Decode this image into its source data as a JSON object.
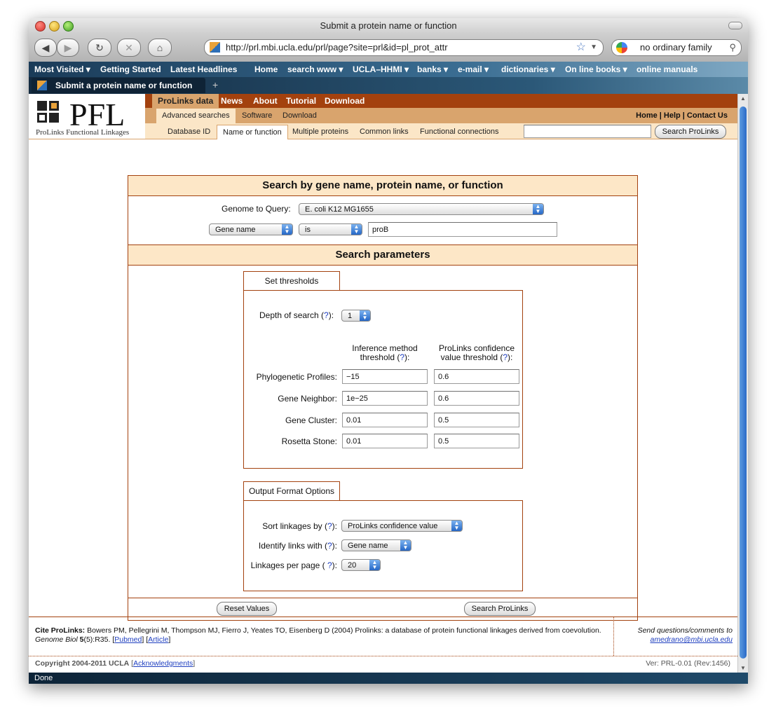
{
  "window": {
    "title": "Submit a protein name or function"
  },
  "toolbar": {
    "url": "http://prl.mbi.ucla.edu/prl/page?site=prl&id=pl_prot_attr",
    "search_value": "no ordinary family"
  },
  "bookmarks": [
    "Most Visited ▾",
    "Getting Started",
    "Latest Headlines",
    "Home",
    "search www ▾",
    "UCLA–HHMI ▾",
    "banks ▾",
    "e-mail ▾",
    "dictionaries ▾",
    "On line books ▾",
    "online manuals"
  ],
  "tab": {
    "title": "Submit a protein name or function"
  },
  "status": {
    "text": "Done"
  },
  "site": {
    "logo": "PFL",
    "logo_sub": "ProLinks Functional Linkages",
    "nav1": [
      "ProLinks data",
      "News",
      "About",
      "Tutorial",
      "Download"
    ],
    "nav2": [
      "Advanced searches",
      "Software",
      "Download"
    ],
    "nav2_right": "Home | Help | Contact Us",
    "nav3": [
      "Database ID",
      "Name or function",
      "Multiple proteins",
      "Common links",
      "Functional connections"
    ],
    "search_button": "Search ProLinks"
  },
  "form": {
    "title": "Search by gene name, protein name, or function",
    "genome_label": "Genome to Query:",
    "genome_value": "E. coli K12 MG1655",
    "field_select": "Gene name",
    "op_select": "is",
    "query_value": "proB",
    "params_title": "Search parameters",
    "thresholds_tab": "Set thresholds",
    "depth_label": "Depth of search (",
    "q": "?",
    "close_paren": "):",
    "depth_value": "1",
    "col1_line1": "Inference method",
    "col1_line2": "threshold (",
    "col2_line1": "ProLinks confidence",
    "col2_line2": "value threshold (",
    "rows": [
      {
        "label": "Phylogenetic Profiles:",
        "method": "−15",
        "conf": "0.6"
      },
      {
        "label": "Gene Neighbor:",
        "method": "1e−25",
        "conf": "0.6"
      },
      {
        "label": "Gene Cluster:",
        "method": "0.01",
        "conf": "0.5"
      },
      {
        "label": "Rosetta Stone:",
        "method": "0.01",
        "conf": "0.5"
      }
    ],
    "output_tab": "Output Format Options",
    "sort_label": "Sort linkages by (",
    "sort_value": "ProLinks confidence value",
    "identify_label": "Identify links with (",
    "identify_value": "Gene name",
    "per_page_label": "Linkages per page ( ",
    "per_page_value": "20",
    "reset_button": "Reset Values",
    "submit_button": "Search ProLinks"
  },
  "footer": {
    "cite_label": "Cite ProLinks:",
    "cite_text": "Bowers PM, Pellegrini M, Thompson MJ, Fierro J, Yeates TO, Eisenberg D (2004) Prolinks: a database of protein functional linkages derived from coevolution.",
    "journal": "Genome Biol",
    "volume": "5",
    "issue": "(5):R35.",
    "pubmed": "Pubmed",
    "article": "Article",
    "send": "Send questions/comments to",
    "email": "amedrano@mbi.ucla.edu",
    "copyright": "Copyright 2004-2011 UCLA",
    "ack": "Acknowledgments",
    "version": "Ver: PRL-0.01 (Rev:1456)"
  }
}
